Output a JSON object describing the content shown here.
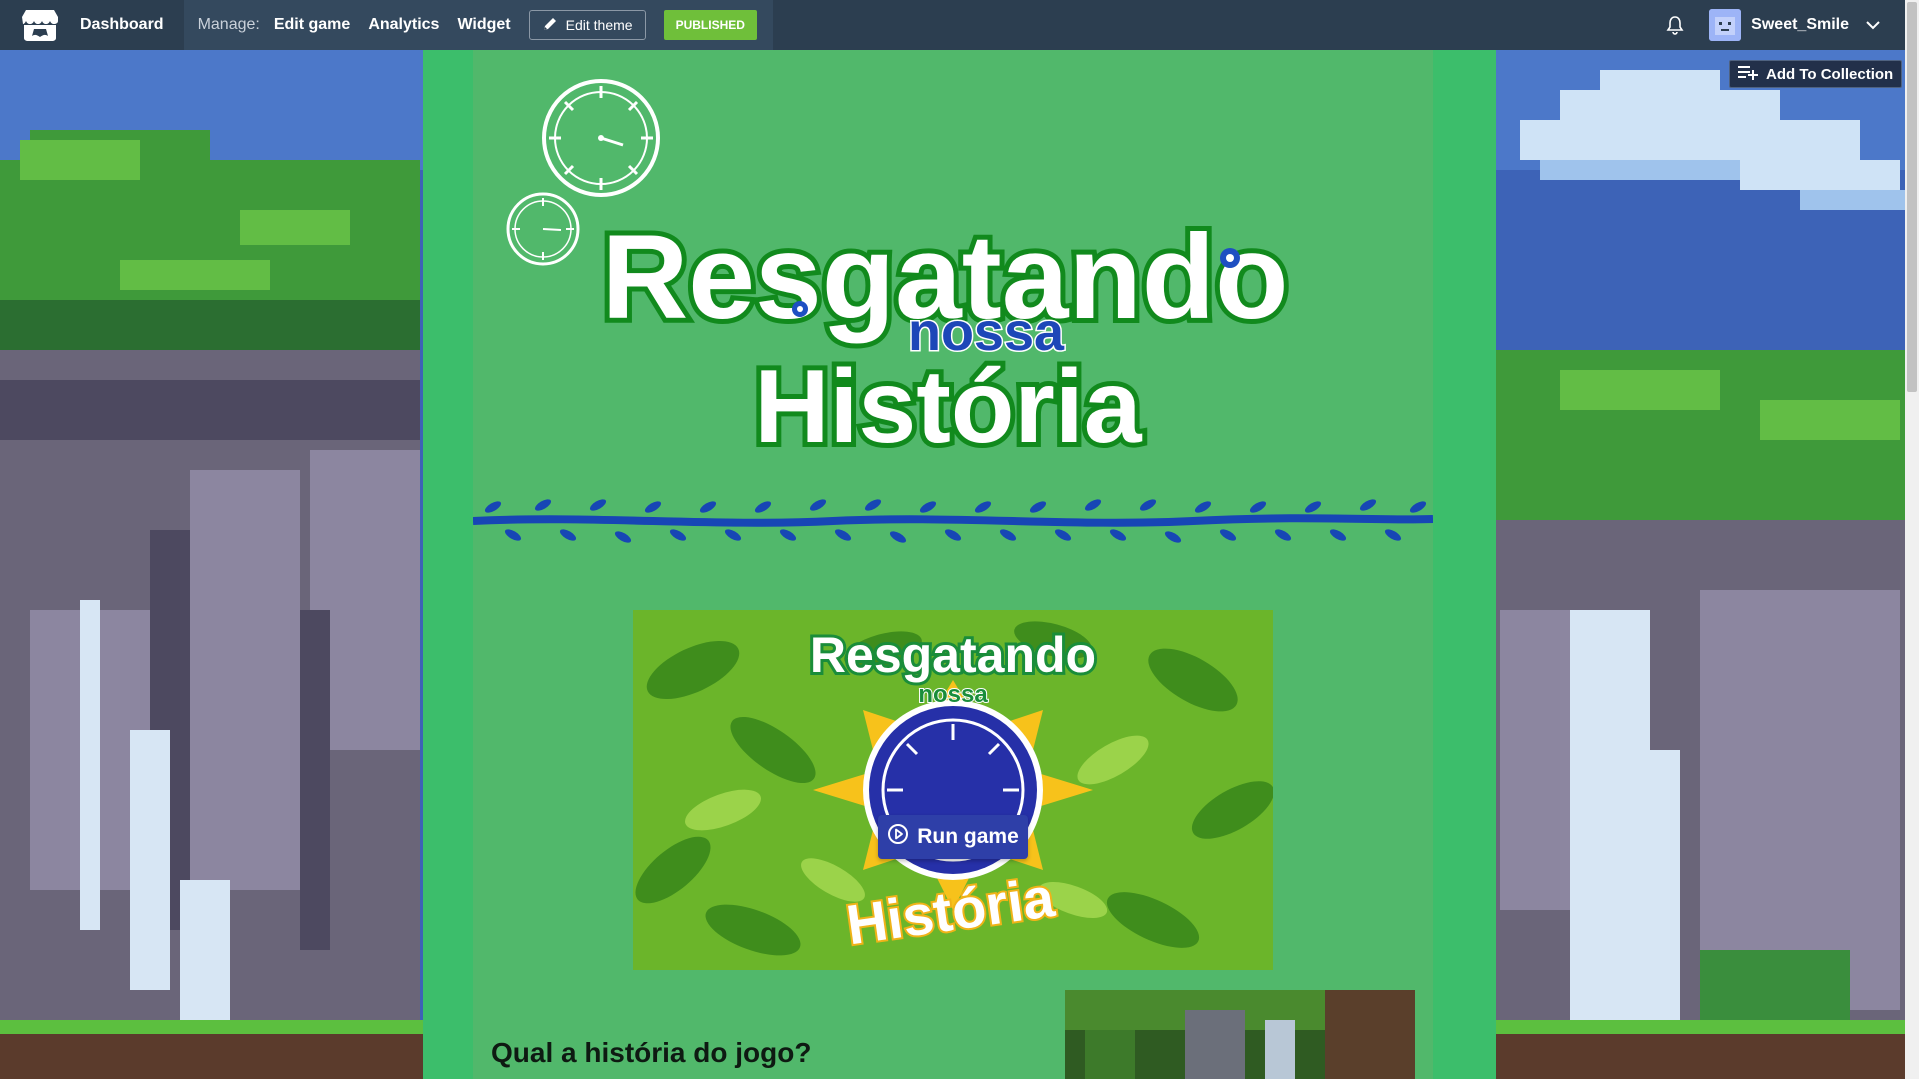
{
  "nav": {
    "dashboard": "Dashboard",
    "manage_label": "Manage:",
    "edit_game": "Edit game",
    "analytics": "Analytics",
    "widget": "Widget",
    "edit_theme": "Edit theme",
    "published": "PUBLISHED",
    "username": "Sweet_Smile"
  },
  "actions": {
    "add_to_collection": "Add To Collection"
  },
  "banner": {
    "title_line1": "Resgatando",
    "title_middle": "nossa",
    "title_line2": "História"
  },
  "embed": {
    "title_line1": "Resgatando",
    "title_middle": "nossa",
    "title_line2": "História",
    "run_game": "Run game"
  },
  "description": {
    "heading": "Qual a história do jogo?"
  },
  "colors": {
    "topbar": "#2c3e50",
    "manage_bar": "#34495e",
    "published": "#6fbf3a",
    "page_outer": "#3cbe6b",
    "page_inner": "#51b86b",
    "vine_blue": "#1746b5",
    "run_button": "#2e3fa8"
  },
  "icons": {
    "logo": "itchio-logo-icon",
    "edit_theme": "pencil-icon",
    "notifications": "bell-icon",
    "dropdown": "chevron-down-icon",
    "add_collection": "playlist-add-icon",
    "run_game": "play-circle-icon"
  }
}
